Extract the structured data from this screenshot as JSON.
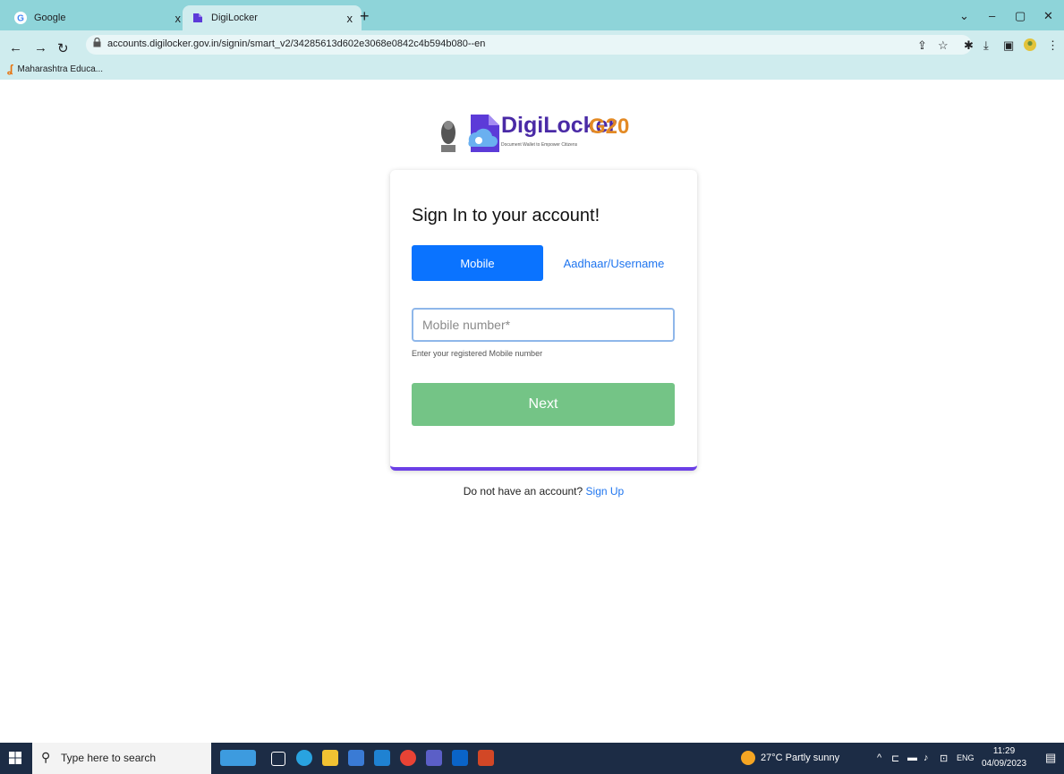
{
  "browser": {
    "tabs": [
      {
        "title": "Google",
        "icon": "google-icon"
      },
      {
        "title": "DigiLocker",
        "icon": "digilocker-icon"
      }
    ],
    "close_glyph": "x",
    "new_tab_glyph": "+",
    "url": "accounts.digilocker.gov.in/signin/smart_v2/34285613d602e3068e0842c4b594b080--en",
    "bookmarks": [
      {
        "label": "Maharashtra Educa..."
      }
    ]
  },
  "header": {
    "brand": "DigiLocker",
    "tagline": "Document Wallet to Empower Citizens",
    "g20": "G20"
  },
  "signin": {
    "title": "Sign In to your account!",
    "tab_mobile": "Mobile",
    "tab_aadhaar": "Aadhaar/Username",
    "mobile_placeholder": "Mobile number*",
    "helper": "Enter your registered Mobile number",
    "next_label": "Next",
    "signup_prompt": "Do not have an account?",
    "signup_link": "Sign Up"
  },
  "taskbar": {
    "search_placeholder": "Type here to search",
    "weather": "27°C  Partly sunny",
    "language": "ENG",
    "time": "11:29",
    "date": "04/09/2023"
  },
  "colors": {
    "primary": "#0a73ff",
    "next": "#74c486",
    "brand": "#4a2aa6",
    "accent_border": "#6b3fe6"
  }
}
